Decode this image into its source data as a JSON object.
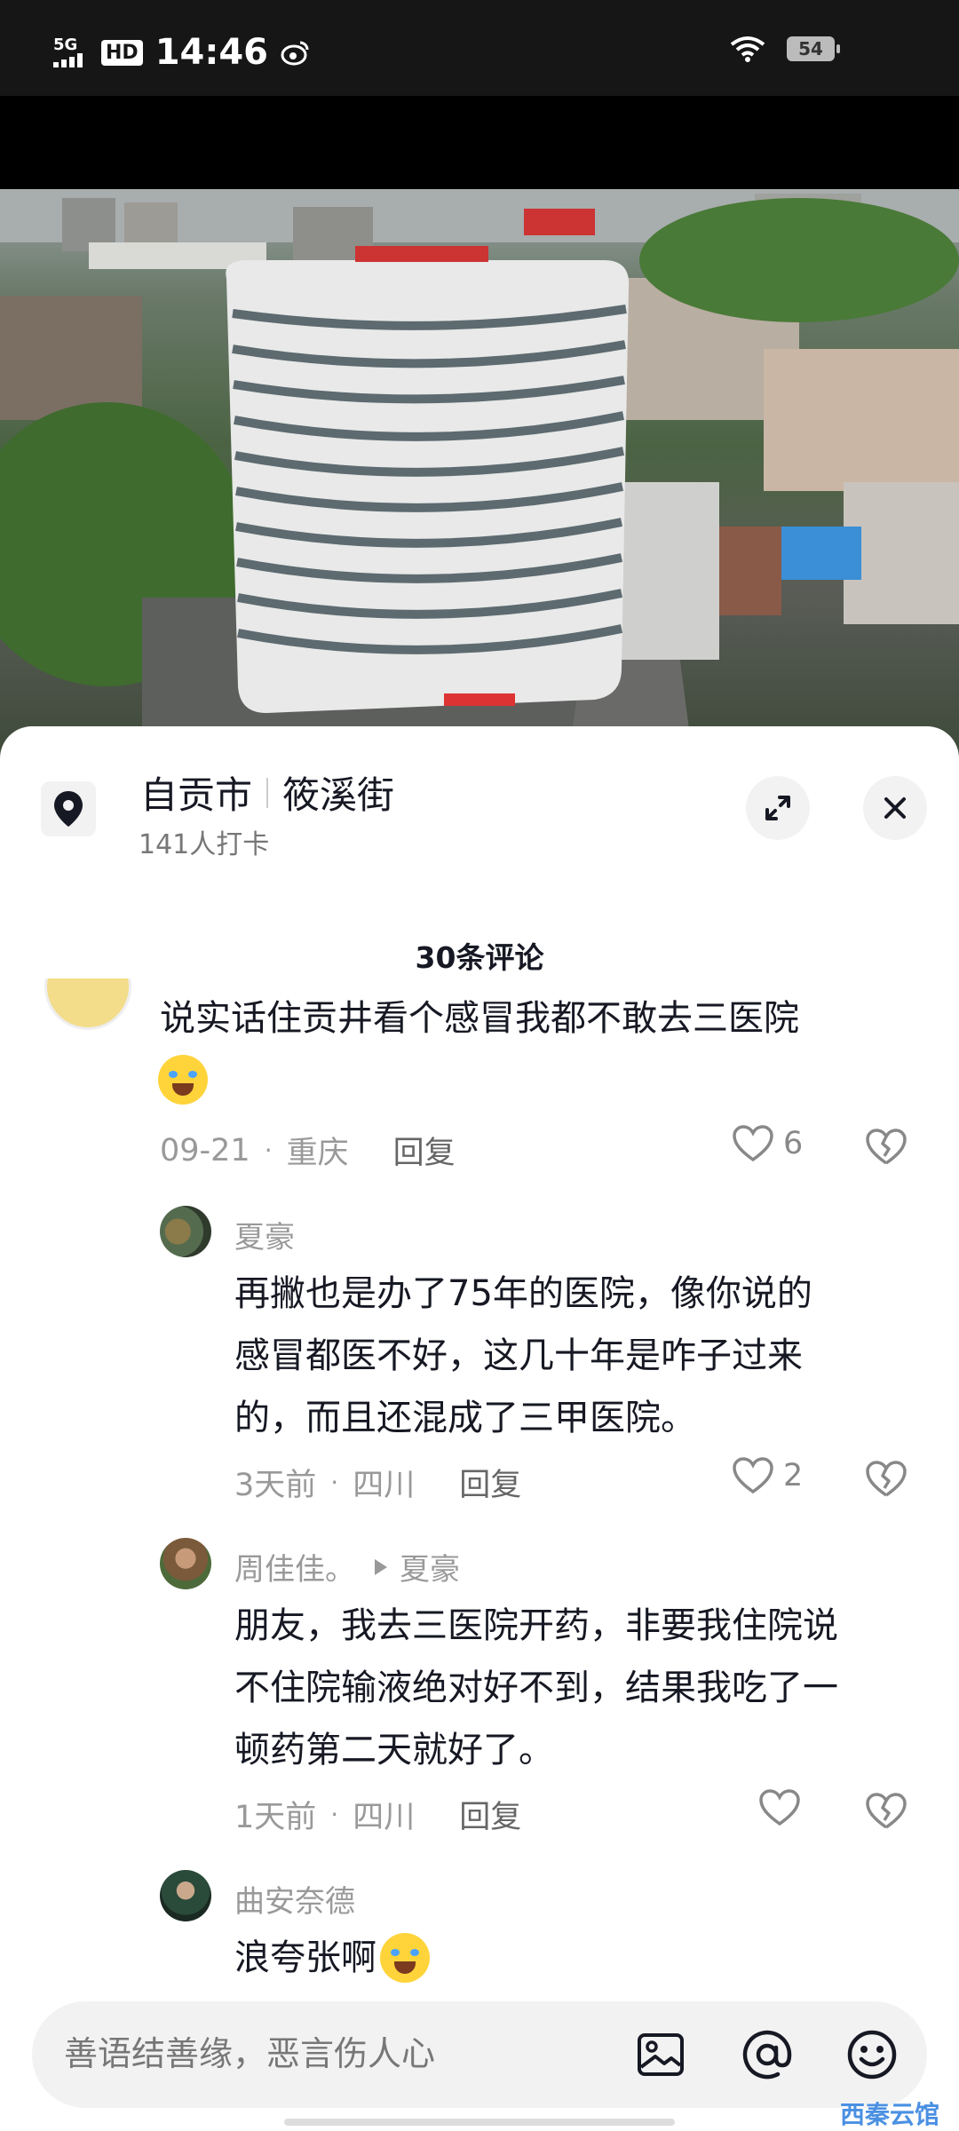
{
  "status_bar": {
    "network": "5G",
    "hd": "HD",
    "time": "14:46",
    "battery": "54"
  },
  "location": {
    "city": "自贡市",
    "street": "筱溪街",
    "checkins": "141人打卡"
  },
  "comments_header": "30条评论",
  "comments": [
    {
      "text": "说实话住贡井看个感冒我都不敢去三医院",
      "date": "09-21",
      "region": "重庆",
      "reply": "回复",
      "likes": "6"
    },
    {
      "user": "夏豪",
      "text_lines": [
        "再撇也是办了75年的医院，像你说的",
        "感冒都医不好，这几十年是咋子过来",
        "的，而且还混成了三甲医院。"
      ],
      "date": "3天前",
      "region": "四川",
      "reply": "回复",
      "likes": "2"
    },
    {
      "user": "周佳佳。",
      "reply_to": "夏豪",
      "text_lines": [
        "朋友，我去三医院开药，非要我住院说",
        "不住院输液绝对好不到，结果我吃了一",
        "顿药第二天就好了。"
      ],
      "date": "1天前",
      "region": "四川",
      "reply": "回复"
    },
    {
      "user": "曲安奈德",
      "text": "浪夸张啊"
    }
  ],
  "input": {
    "placeholder": "善语结善缘，恶言伤人心"
  },
  "watermark": "西秦云馆"
}
